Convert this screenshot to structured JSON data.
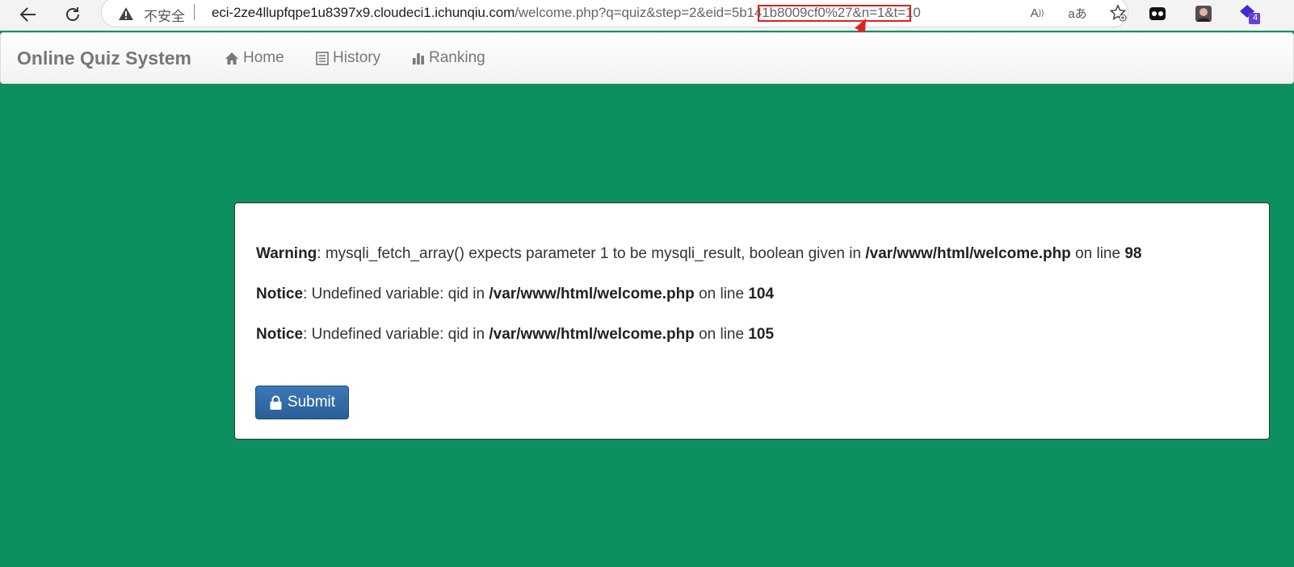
{
  "browser": {
    "insecure_label": "不安全",
    "url_host": "eci-2ze4llupfqpe1u8397x9.cloudeci1.ichunqiu.com",
    "url_rest": "/welcome.php?q=quiz&step=2&eid=5b141b8009cf0%27&n=1&t=10",
    "read_aloud_glyph": "A",
    "translate_glyph": "aあ",
    "extension_badge": "4",
    "icons": [
      "back-arrow-icon",
      "reload-icon",
      "warning-icon",
      "read-aloud-icon",
      "translate-icon",
      "favorite-icon",
      "extension-icon"
    ]
  },
  "navbar": {
    "brand": "Online Quiz System",
    "items": [
      {
        "label": "Home",
        "icon": "home-icon"
      },
      {
        "label": "History",
        "icon": "list-icon"
      },
      {
        "label": "Ranking",
        "icon": "bar-chart-icon"
      }
    ]
  },
  "messages": [
    {
      "level": "Warning",
      "text": ": mysqli_fetch_array() expects parameter 1 to be mysqli_result, boolean given in ",
      "file": "/var/www/html/welcome.php",
      "suffix": " on line ",
      "line": "98"
    },
    {
      "level": "Notice",
      "text": ": Undefined variable: qid in ",
      "file": "/var/www/html/welcome.php",
      "suffix": " on line ",
      "line": "104"
    },
    {
      "level": "Notice",
      "text": ": Undefined variable: qid in ",
      "file": "/var/www/html/welcome.php",
      "suffix": " on line ",
      "line": "105"
    }
  ],
  "submit_label": "Submit",
  "colors": {
    "page_background": "#0c9060",
    "annotation": "#e02020",
    "submit_button": "#2f6ba8"
  }
}
